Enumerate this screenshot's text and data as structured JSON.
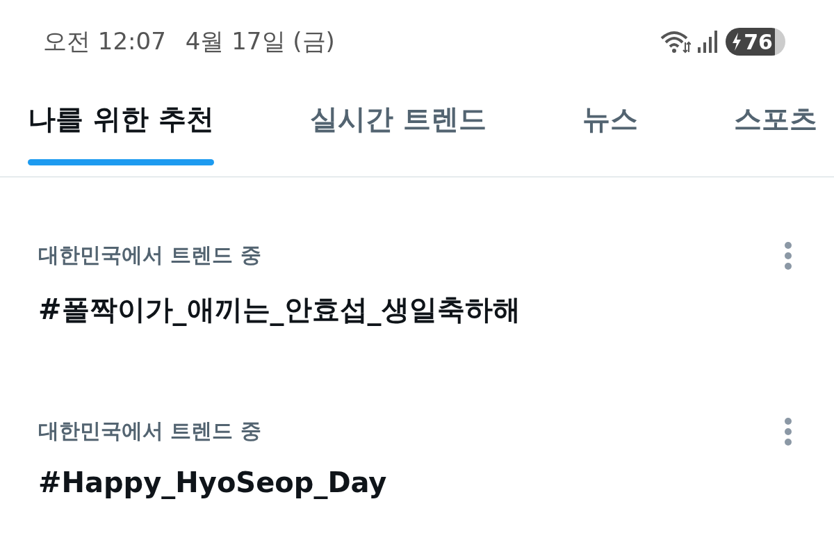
{
  "status_bar": {
    "time": "오전 12:07",
    "date": "4월 17일 (금)",
    "battery": "76"
  },
  "tabs": [
    {
      "label": "나를 위한 추천",
      "selected": true
    },
    {
      "label": "실시간 트렌드",
      "selected": false
    },
    {
      "label": "뉴스",
      "selected": false
    },
    {
      "label": "스포츠",
      "selected": false
    }
  ],
  "trends": [
    {
      "context": "대한민국에서 트렌드 중",
      "title": "#폴짝이가_애끼는_안효섭_생일축하해"
    },
    {
      "context": "대한민국에서 트렌드 중",
      "title": "#Happy_HyoSeop_Day"
    }
  ]
}
